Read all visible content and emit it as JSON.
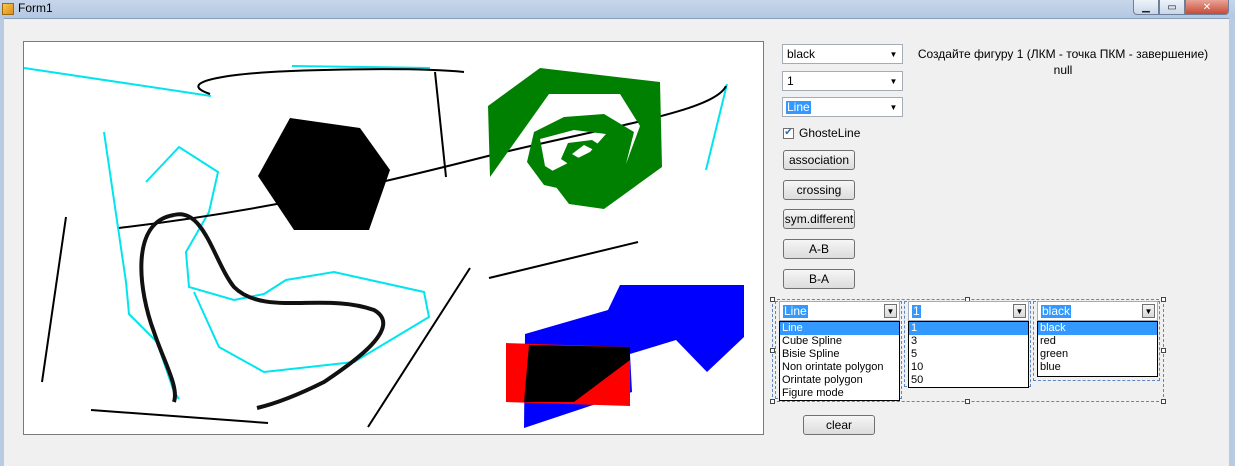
{
  "window": {
    "title": "Form1",
    "min_icon": "minimize-icon",
    "max_icon": "maximize-icon",
    "close_icon": "close-icon"
  },
  "controls": {
    "color_combo": "black",
    "width_combo": "1",
    "mode_combo": "Line",
    "ghost_checkbox": {
      "label": "GhosteLine",
      "checked": true
    }
  },
  "buttons": {
    "association": "association",
    "crossing": "crossing",
    "sym_different": "sym.different",
    "a_minus_b": "A-B",
    "b_minus_a": "B-A",
    "clear": "clear"
  },
  "info": {
    "instruction": "Создайте фигуру 1 (ЛКМ - точка ПКМ - завершение)",
    "status": "null"
  },
  "designer": {
    "mode_list": {
      "selected": "Line",
      "options": [
        "Line",
        "Cube Spline",
        "Bisie Spline",
        "Non orintate polygon",
        "Orintate polygon",
        "Figure mode"
      ]
    },
    "width_list": {
      "selected": "1",
      "options": [
        "1",
        "3",
        "5",
        "10",
        "50"
      ]
    },
    "color_list": {
      "selected": "black",
      "options": [
        "black",
        "red",
        "green",
        "blue"
      ]
    }
  },
  "colors": {
    "selection": "#3399ff",
    "cyan": "#00e5ee",
    "green": "#008000",
    "blue": "#0000ff",
    "red": "#ff0000",
    "black": "#000000"
  }
}
